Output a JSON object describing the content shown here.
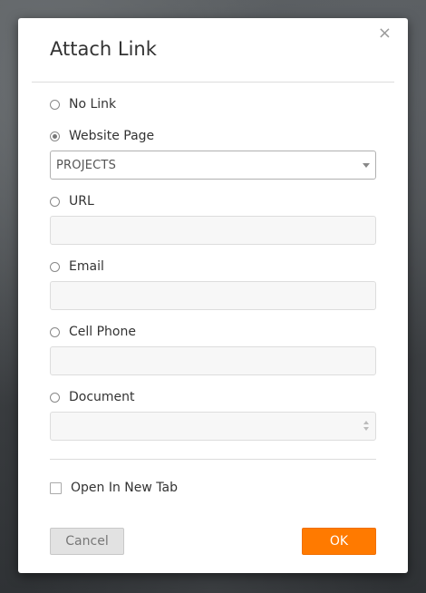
{
  "dialog": {
    "title": "Attach Link",
    "close_glyph": "×"
  },
  "options": {
    "no_link": {
      "label": "No Link",
      "checked": false
    },
    "website_page": {
      "label": "Website Page",
      "checked": true,
      "selected_value": "PROJECTS"
    },
    "url": {
      "label": "URL",
      "checked": false,
      "value": ""
    },
    "email": {
      "label": "Email",
      "checked": false,
      "value": ""
    },
    "cell_phone": {
      "label": "Cell Phone",
      "checked": false,
      "value": ""
    },
    "document": {
      "label": "Document",
      "checked": false,
      "value": ""
    }
  },
  "open_in_new_tab": {
    "label": "Open In New Tab",
    "checked": false
  },
  "buttons": {
    "cancel": "Cancel",
    "ok": "OK"
  },
  "colors": {
    "ok_button": "#ff7a00",
    "cancel_button": "#e2e2e2"
  }
}
